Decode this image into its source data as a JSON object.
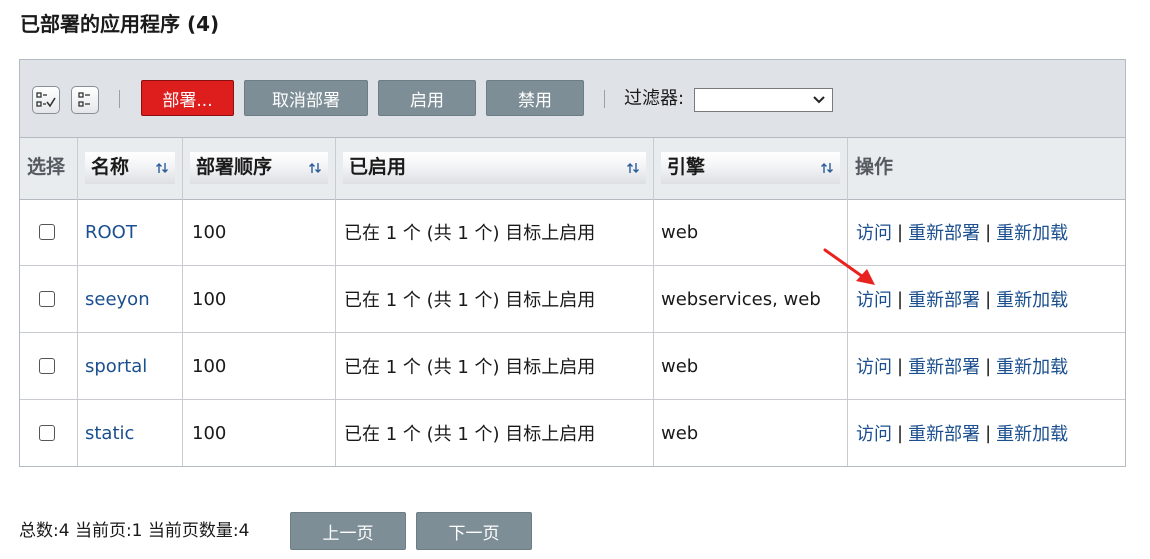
{
  "page": {
    "title": "已部署的应用程序 (4)"
  },
  "toolbar": {
    "deploy_label": "部署...",
    "undeploy_label": "取消部署",
    "enable_label": "启用",
    "disable_label": "禁用",
    "filter_label": "过滤器:",
    "filter_value": ""
  },
  "table": {
    "headers": {
      "select": "选择",
      "name": "名称",
      "order": "部署顺序",
      "enabled": "已启用",
      "engine": "引擎",
      "actions": "操作"
    },
    "rows": [
      {
        "name": "ROOT",
        "order": "100",
        "enabled": "已在 1 个 (共 1 个) 目标上启用",
        "engine": "web"
      },
      {
        "name": "seeyon",
        "order": "100",
        "enabled": "已在 1 个 (共 1 个) 目标上启用",
        "engine": "webservices, web"
      },
      {
        "name": "sportal",
        "order": "100",
        "enabled": "已在 1 个 (共 1 个) 目标上启用",
        "engine": "web"
      },
      {
        "name": "static",
        "order": "100",
        "enabled": "已在 1 个 (共 1 个) 目标上启用",
        "engine": "web"
      }
    ],
    "actions": {
      "visit": "访问",
      "redeploy": "重新部署",
      "reload": "重新加载",
      "separator": "|"
    }
  },
  "footer": {
    "summary": "总数:4 当前页:1 当前页数量:4",
    "prev_label": "上一页",
    "next_label": "下一页"
  },
  "colors": {
    "accent_red": "#de1d1d",
    "button_gray": "#7d8e97",
    "link_blue": "#1b4f8f",
    "annotation_red": "#e8231f"
  }
}
